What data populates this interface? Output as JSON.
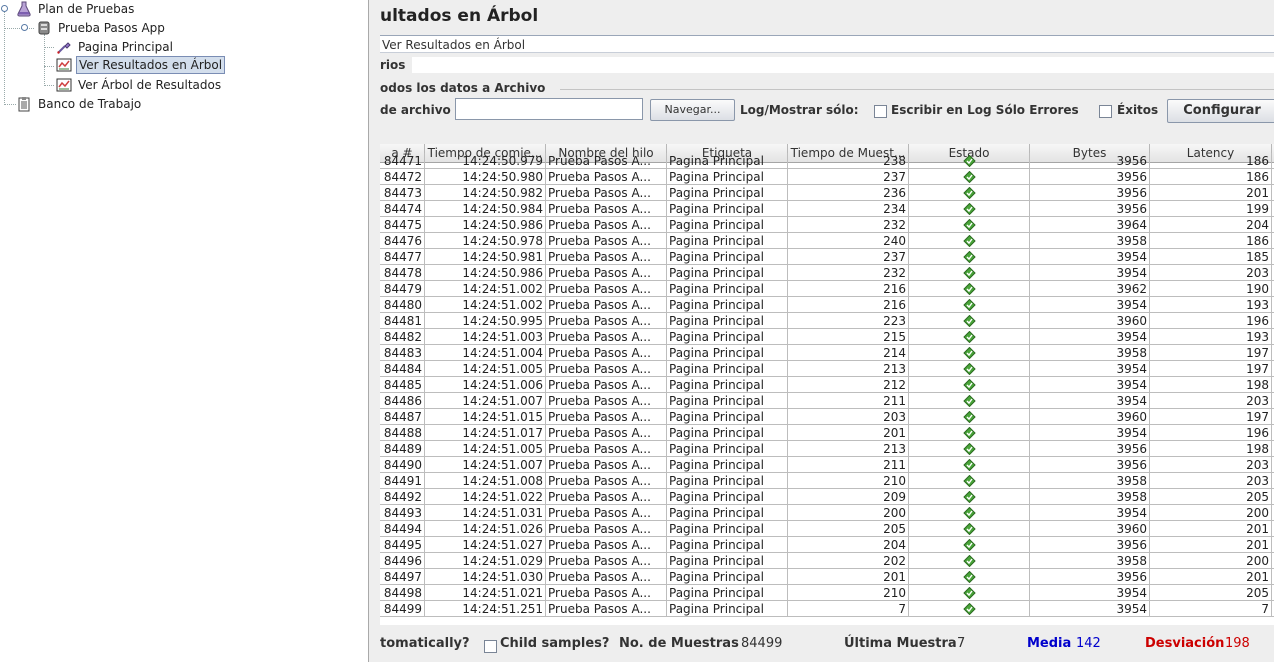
{
  "tree": {
    "items": [
      {
        "label": "Plan de Pruebas",
        "icon": "flask-icon"
      },
      {
        "label": "Prueba Pasos App",
        "icon": "thread-group-icon"
      },
      {
        "label": "Pagina Principal",
        "icon": "pipette-sampler-icon"
      },
      {
        "label": "Ver Resultados en Árbol",
        "icon": "results-tree-listener-icon",
        "selected": true
      },
      {
        "label": "Ver Árbol de Resultados",
        "icon": "results-tree-listener-icon"
      },
      {
        "label": "Banco de Trabajo",
        "icon": "workbench-clipboard-icon"
      }
    ]
  },
  "panel": {
    "title": "ultados en Árbol",
    "name_value": "Ver Resultados en Árbol",
    "comments_label": "rios",
    "file_section": "odos los datos a Archivo",
    "file_label": "de archivo",
    "browse_label": "Navegar...",
    "log_label": "Log/Mostrar sólo:",
    "errors_label": "Escribir en Log Sólo Errores",
    "success_label": "Éxitos",
    "configure_label": "Configurar"
  },
  "table": {
    "columns": [
      "a #",
      "Tiempo de comie...",
      "Nombre del hilo",
      "Etiqueta",
      "Tiempo de Muest...",
      "Estado",
      "Bytes",
      "Latency"
    ],
    "status_icon": "success-shield-icon",
    "rows": [
      [
        "84471",
        "14:24:50.979",
        "Prueba Pasos A...",
        "Pagina Principal",
        "238",
        "3956",
        "186"
      ],
      [
        "84472",
        "14:24:50.980",
        "Prueba Pasos A...",
        "Pagina Principal",
        "237",
        "3956",
        "186"
      ],
      [
        "84473",
        "14:24:50.982",
        "Prueba Pasos A...",
        "Pagina Principal",
        "236",
        "3956",
        "201"
      ],
      [
        "84474",
        "14:24:50.984",
        "Prueba Pasos A...",
        "Pagina Principal",
        "234",
        "3956",
        "199"
      ],
      [
        "84475",
        "14:24:50.986",
        "Prueba Pasos A...",
        "Pagina Principal",
        "232",
        "3964",
        "204"
      ],
      [
        "84476",
        "14:24:50.978",
        "Prueba Pasos A...",
        "Pagina Principal",
        "240",
        "3958",
        "186"
      ],
      [
        "84477",
        "14:24:50.981",
        "Prueba Pasos A...",
        "Pagina Principal",
        "237",
        "3954",
        "185"
      ],
      [
        "84478",
        "14:24:50.986",
        "Prueba Pasos A...",
        "Pagina Principal",
        "232",
        "3954",
        "203"
      ],
      [
        "84479",
        "14:24:51.002",
        "Prueba Pasos A...",
        "Pagina Principal",
        "216",
        "3962",
        "190"
      ],
      [
        "84480",
        "14:24:51.002",
        "Prueba Pasos A...",
        "Pagina Principal",
        "216",
        "3954",
        "193"
      ],
      [
        "84481",
        "14:24:50.995",
        "Prueba Pasos A...",
        "Pagina Principal",
        "223",
        "3960",
        "196"
      ],
      [
        "84482",
        "14:24:51.003",
        "Prueba Pasos A...",
        "Pagina Principal",
        "215",
        "3954",
        "193"
      ],
      [
        "84483",
        "14:24:51.004",
        "Prueba Pasos A...",
        "Pagina Principal",
        "214",
        "3958",
        "197"
      ],
      [
        "84484",
        "14:24:51.005",
        "Prueba Pasos A...",
        "Pagina Principal",
        "213",
        "3954",
        "197"
      ],
      [
        "84485",
        "14:24:51.006",
        "Prueba Pasos A...",
        "Pagina Principal",
        "212",
        "3954",
        "198"
      ],
      [
        "84486",
        "14:24:51.007",
        "Prueba Pasos A...",
        "Pagina Principal",
        "211",
        "3954",
        "203"
      ],
      [
        "84487",
        "14:24:51.015",
        "Prueba Pasos A...",
        "Pagina Principal",
        "203",
        "3960",
        "197"
      ],
      [
        "84488",
        "14:24:51.017",
        "Prueba Pasos A...",
        "Pagina Principal",
        "201",
        "3954",
        "196"
      ],
      [
        "84489",
        "14:24:51.005",
        "Prueba Pasos A...",
        "Pagina Principal",
        "213",
        "3956",
        "198"
      ],
      [
        "84490",
        "14:24:51.007",
        "Prueba Pasos A...",
        "Pagina Principal",
        "211",
        "3956",
        "203"
      ],
      [
        "84491",
        "14:24:51.008",
        "Prueba Pasos A...",
        "Pagina Principal",
        "210",
        "3958",
        "203"
      ],
      [
        "84492",
        "14:24:51.022",
        "Prueba Pasos A...",
        "Pagina Principal",
        "209",
        "3958",
        "205"
      ],
      [
        "84493",
        "14:24:51.031",
        "Prueba Pasos A...",
        "Pagina Principal",
        "200",
        "3954",
        "200"
      ],
      [
        "84494",
        "14:24:51.026",
        "Prueba Pasos A...",
        "Pagina Principal",
        "205",
        "3960",
        "201"
      ],
      [
        "84495",
        "14:24:51.027",
        "Prueba Pasos A...",
        "Pagina Principal",
        "204",
        "3956",
        "201"
      ],
      [
        "84496",
        "14:24:51.029",
        "Prueba Pasos A...",
        "Pagina Principal",
        "202",
        "3958",
        "200"
      ],
      [
        "84497",
        "14:24:51.030",
        "Prueba Pasos A...",
        "Pagina Principal",
        "201",
        "3956",
        "201"
      ],
      [
        "84498",
        "14:24:51.021",
        "Prueba Pasos A...",
        "Pagina Principal",
        "210",
        "3954",
        "205"
      ],
      [
        "84499",
        "14:24:51.251",
        "Prueba Pasos A...",
        "Pagina Principal",
        "7",
        "3954",
        "7"
      ]
    ]
  },
  "footer": {
    "auto_label": "tomatically?",
    "child_label": "Child samples?",
    "samples_label": "No. de Muestras",
    "samples_value": "84499",
    "last_label": "Última Muestra",
    "last_value": "7",
    "mean_label": "Media",
    "mean_value": "142",
    "dev_label": "Desviación",
    "dev_value": "198"
  },
  "colors": {
    "mean": "#0000cc",
    "deviation": "#cc0000",
    "selection": "#d3deec"
  }
}
